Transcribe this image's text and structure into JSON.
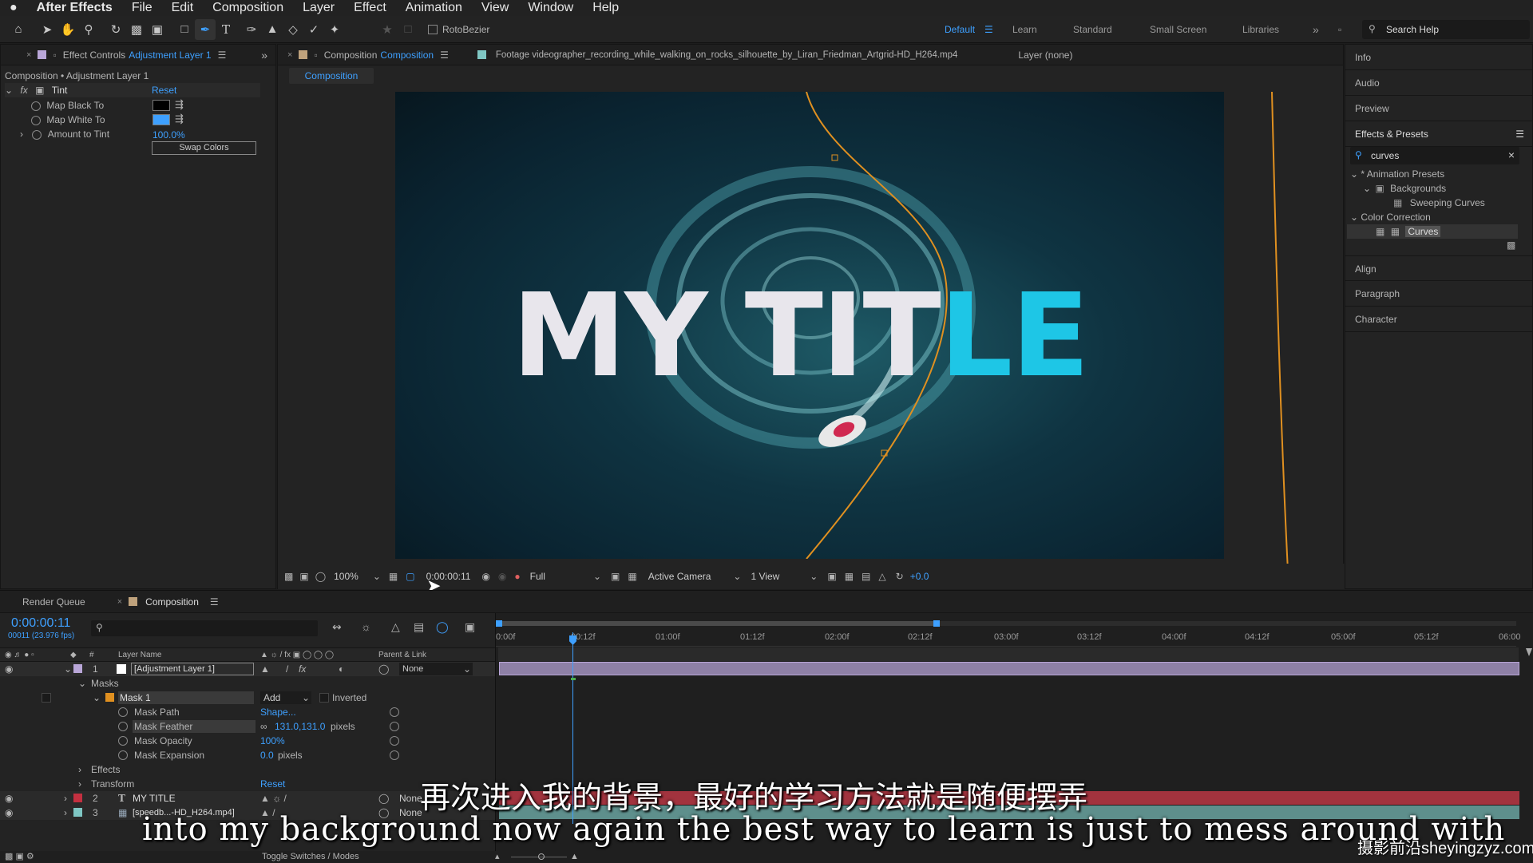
{
  "menubar": {
    "apple": "",
    "items": [
      "After Effects",
      "File",
      "Edit",
      "Composition",
      "Layer",
      "Effect",
      "Animation",
      "View",
      "Window",
      "Help"
    ]
  },
  "toolbar": {
    "rotobezier_label": "RotoBezier",
    "workspaces": [
      "Default",
      "Learn",
      "Standard",
      "Small Screen",
      "Libraries"
    ],
    "search_help": "Search Help"
  },
  "effect_controls": {
    "tab_prefix": "Effect Controls",
    "tab_layer": "Adjustment Layer 1",
    "path": "Composition • Adjustment Layer 1",
    "fx_name": "Tint",
    "reset": "Reset",
    "map_black": "Map Black To",
    "map_white": "Map White To",
    "amount_label": "Amount to Tint",
    "amount_value": "100.0%",
    "swap_colors": "Swap Colors",
    "black_color": "#000000",
    "white_color": "#3ea0ff"
  },
  "viewer": {
    "comp_tab_prefix": "Composition",
    "comp_tab_name": "Composition",
    "footage_tab": "Footage videographer_recording_while_walking_on_rocks_silhouette_by_Liran_Friedman_Artgrid-HD_H264.mp4",
    "layer_tab": "Layer (none)",
    "subtab": "Composition",
    "title_white": "MY TIT",
    "title_cyan": "LE",
    "zoom": "100%",
    "timecode": "0:00:00:11",
    "resolution": "Full",
    "camera": "Active Camera",
    "views": "1 View",
    "exposure": "+0.0"
  },
  "right_panel": {
    "items": [
      "Info",
      "Audio",
      "Preview"
    ],
    "effects_presets": "Effects & Presets",
    "search_value": "curves",
    "tree": {
      "animation_presets": "* Animation Presets",
      "backgrounds": "Backgrounds",
      "sweeping_curves": "Sweeping Curves",
      "color_correction": "Color Correction",
      "curves": "Curves"
    },
    "bottom_items": [
      "Align",
      "Paragraph",
      "Character"
    ]
  },
  "timeline": {
    "render_queue": "Render Queue",
    "comp_tab": "Composition",
    "timecode": "0:00:00:11",
    "frame_info": "00011 (23.976 fps)",
    "col_layer_name": "Layer Name",
    "col_parent": "Parent & Link",
    "ruler": [
      "0:00f",
      "00:12f",
      "01:00f",
      "01:12f",
      "02:00f",
      "02:12f",
      "03:00f",
      "03:12f",
      "04:00f",
      "04:12f",
      "05:00f",
      "05:12f",
      "06:00"
    ],
    "layers": [
      {
        "num": "1",
        "name": "[Adjustment Layer 1]",
        "parent": "None",
        "color": "#b9a6d8"
      },
      {
        "num": "2",
        "name": "MY TITLE",
        "parent": "None",
        "color": "#c33040"
      },
      {
        "num": "3",
        "name": "[speedb...-HD_H264.mp4]",
        "parent": "None",
        "color": "#7fc7c4"
      }
    ],
    "masks_label": "Masks",
    "mask_name": "Mask 1",
    "mask_mode": "Add",
    "inverted": "Inverted",
    "mask_path": "Mask Path",
    "mask_path_val": "Shape...",
    "mask_feather": "Mask Feather",
    "mask_feather_val": "131.0,131.0",
    "mask_feather_unit": "pixels",
    "mask_opacity": "Mask Opacity",
    "mask_opacity_val": "100%",
    "mask_expansion": "Mask Expansion",
    "mask_expansion_val": "0.0",
    "mask_expansion_unit": "pixels",
    "effects": "Effects",
    "transform": "Transform",
    "transform_reset": "Reset",
    "toggle": "Toggle Switches / Modes"
  },
  "subtitles": {
    "cn": "再次进入我的背景，最好的学习方法就是随便摆弄",
    "en": "into my background now again the best way to learn is just to mess around with"
  },
  "watermark": "摄影前沿sheyingzyz.com"
}
